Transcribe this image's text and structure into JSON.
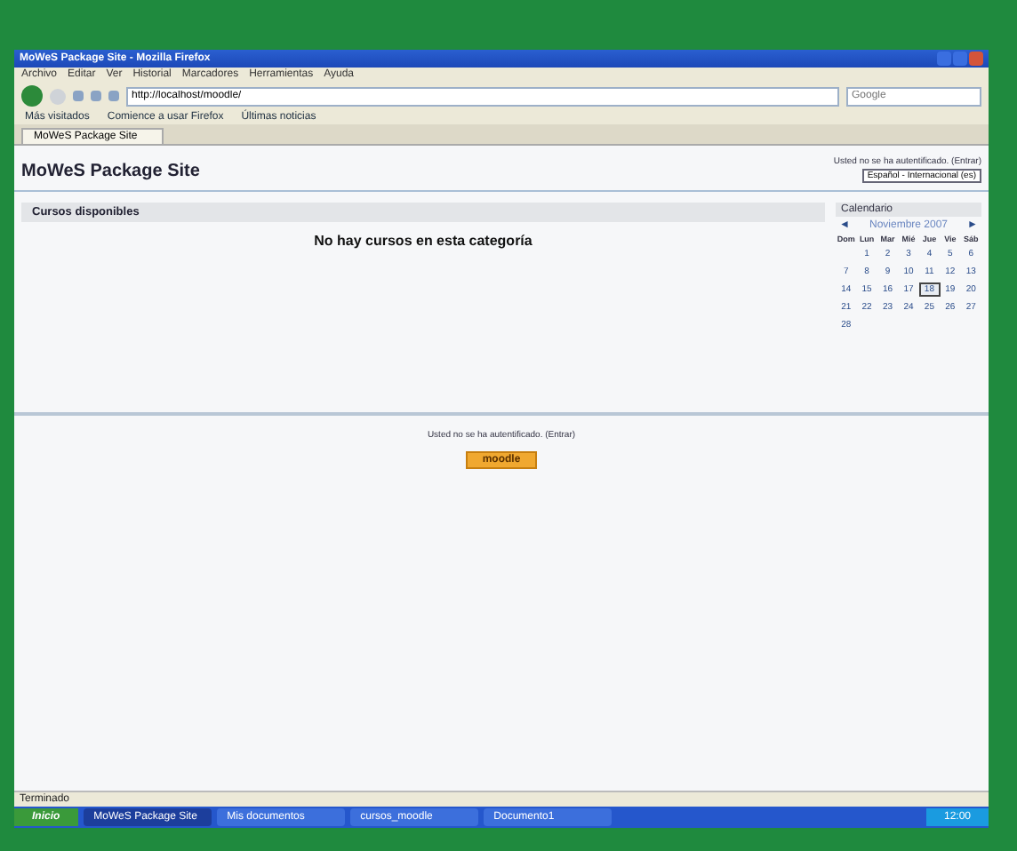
{
  "window": {
    "title": "MoWeS Package Site - Mozilla Firefox"
  },
  "menu": [
    "Archivo",
    "Editar",
    "Ver",
    "Historial",
    "Marcadores",
    "Herramientas",
    "Ayuda"
  ],
  "address": {
    "value": "http://localhost/moodle/"
  },
  "search": {
    "placeholder": "Google"
  },
  "bookmarks": [
    "Más visitados",
    "Comience a usar Firefox",
    "Últimas noticias"
  ],
  "tabs": [
    {
      "label": "MoWeS Package Site",
      "selected": true
    }
  ],
  "page": {
    "site_title": "MoWeS Package Site",
    "login_info": "Usted no se ha autentificado. (Entrar)",
    "language": "Español - Internacional (es)",
    "block_title": "Cursos disponibles",
    "empty_message": "No hay cursos en esta categoría",
    "footer_login": "Usted no se ha autentificado. (Entrar)",
    "footer_button": "moodle"
  },
  "calendar": {
    "title": "Calendario",
    "month": "Noviembre 2007",
    "prev": "◄",
    "next": "►",
    "weekdays": [
      "Dom",
      "Lun",
      "Mar",
      "Mié",
      "Jue",
      "Vie",
      "Sáb"
    ],
    "days": [
      {
        "d": "1",
        "selected": false
      },
      {
        "d": "2",
        "selected": false
      },
      {
        "d": "3",
        "selected": false
      },
      {
        "d": "4",
        "selected": false
      },
      {
        "d": "5",
        "selected": false
      },
      {
        "d": "6",
        "selected": false
      },
      {
        "d": "7",
        "selected": false
      },
      {
        "d": "8",
        "selected": false
      },
      {
        "d": "9",
        "selected": false
      },
      {
        "d": "10",
        "selected": false
      },
      {
        "d": "11",
        "selected": false
      },
      {
        "d": "12",
        "selected": false
      },
      {
        "d": "13",
        "selected": false
      },
      {
        "d": "14",
        "selected": false
      },
      {
        "d": "15",
        "selected": false
      },
      {
        "d": "16",
        "selected": false
      },
      {
        "d": "17",
        "selected": false
      },
      {
        "d": "18",
        "selected": true
      },
      {
        "d": "19",
        "selected": false
      },
      {
        "d": "20",
        "selected": false
      },
      {
        "d": "21",
        "selected": false
      },
      {
        "d": "22",
        "selected": false
      },
      {
        "d": "23",
        "selected": false
      },
      {
        "d": "24",
        "selected": false
      },
      {
        "d": "25",
        "selected": false
      },
      {
        "d": "26",
        "selected": false
      },
      {
        "d": "27",
        "selected": false
      },
      {
        "d": "28",
        "selected": false
      }
    ]
  },
  "status_bar": "Terminado",
  "taskbar": {
    "start": "Inicio",
    "tasks": [
      {
        "label": "MoWeS Package Site",
        "selected": true
      },
      {
        "label": "Mis documentos",
        "selected": false
      },
      {
        "label": "cursos_moodle",
        "selected": false
      },
      {
        "label": "Documento1",
        "selected": false
      }
    ],
    "clock": "12:00"
  }
}
